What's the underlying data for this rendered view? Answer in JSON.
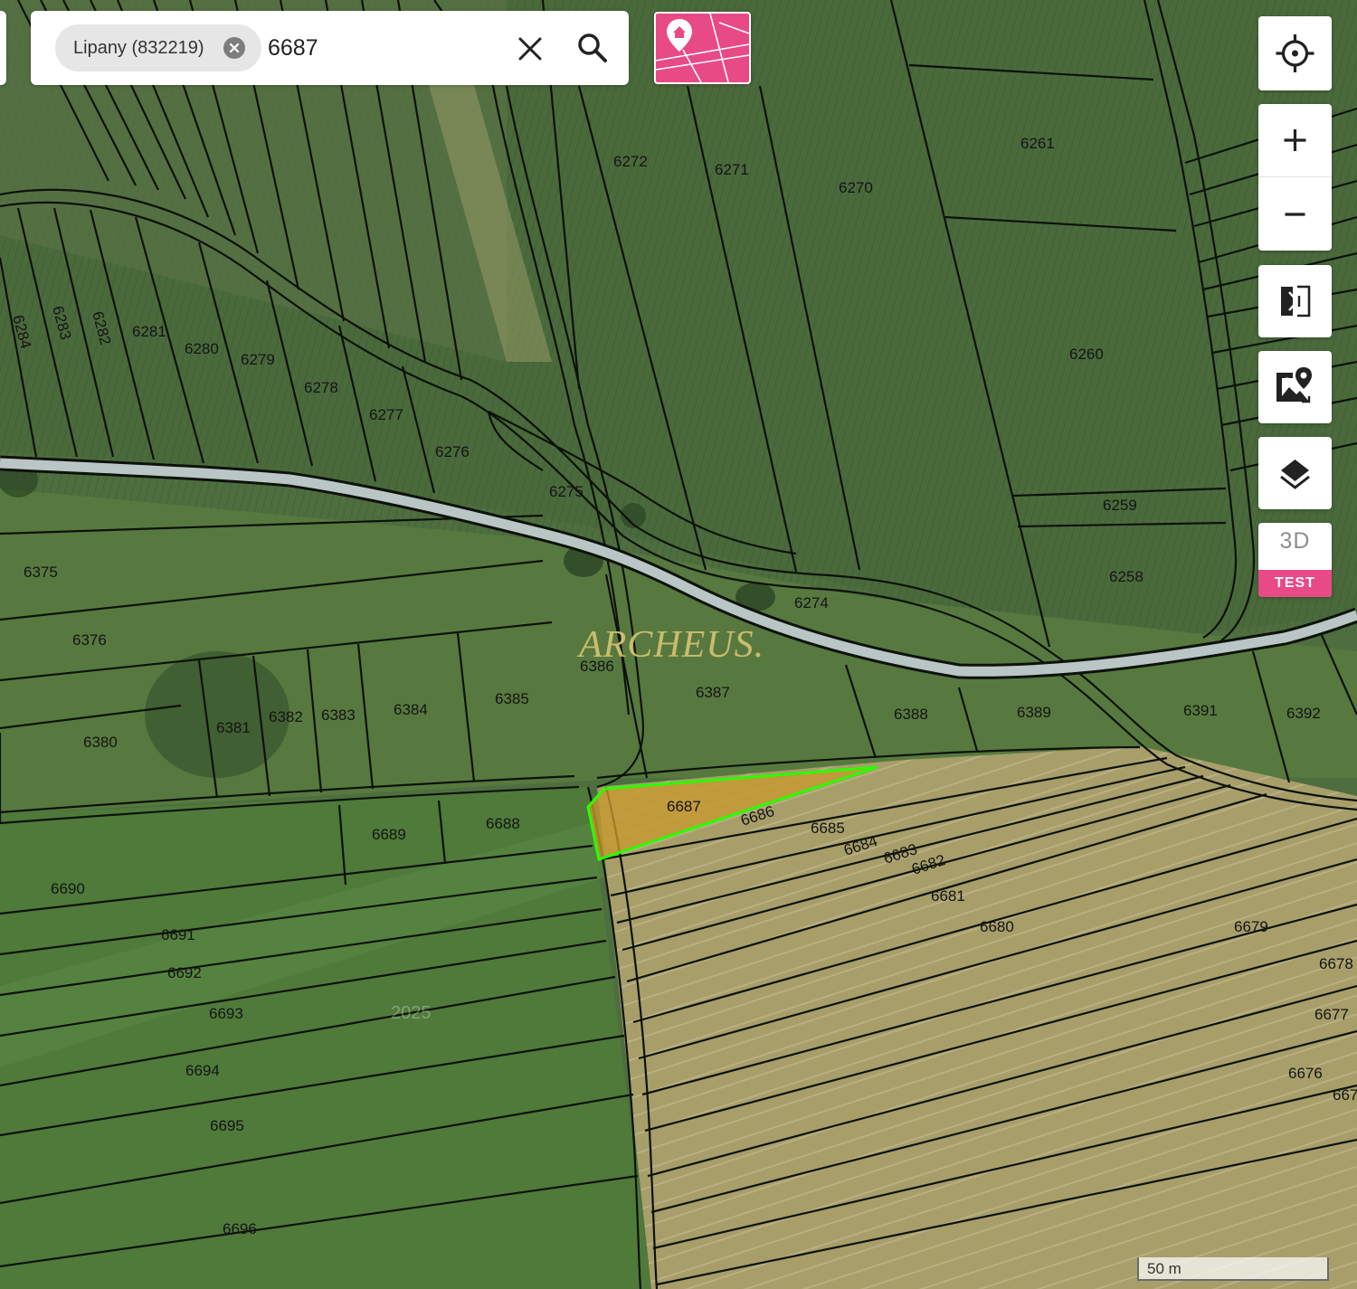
{
  "search": {
    "chip_label": "Lipany (832219)",
    "query": "6687"
  },
  "map": {
    "watermark_brand": "ARCHEUS.",
    "watermark_year": "2025",
    "highlight_parcel": "6687",
    "parcel_labels": [
      "6261",
      "6272",
      "6271",
      "6270",
      "6284",
      "6283",
      "6282",
      "6281",
      "6280",
      "6279",
      "6278",
      "6277",
      "6276",
      "6260",
      "6275",
      "6259",
      "6375",
      "6258",
      "6274",
      "6376",
      "6386",
      "6387",
      "6385",
      "6384",
      "6388",
      "6389",
      "6391",
      "6392",
      "6381",
      "6382",
      "6383",
      "6380",
      "6687",
      "6686",
      "6685",
      "6689",
      "6688",
      "6684",
      "6683",
      "6682",
      "6681",
      "6690",
      "6680",
      "6679",
      "6691",
      "6678",
      "6692",
      "6693",
      "6677",
      "6694",
      "6676",
      "667",
      "6695",
      "6696"
    ],
    "colors": {
      "highlight_fill": "#c8992e",
      "highlight_stroke": "#2aff00",
      "parcel_line": "#0d120a",
      "road": "#b9c6c5"
    }
  },
  "controls": {
    "locate": "crosshair-icon",
    "zoom_in": "plus-icon",
    "zoom_out": "minus-icon",
    "compare": "compare-icon",
    "map_source": "map-pin-icon",
    "layers": "layers-icon",
    "mode_3d_label": "3D",
    "mode_3d_badge": "TEST"
  },
  "scale": {
    "label": "50 m"
  }
}
